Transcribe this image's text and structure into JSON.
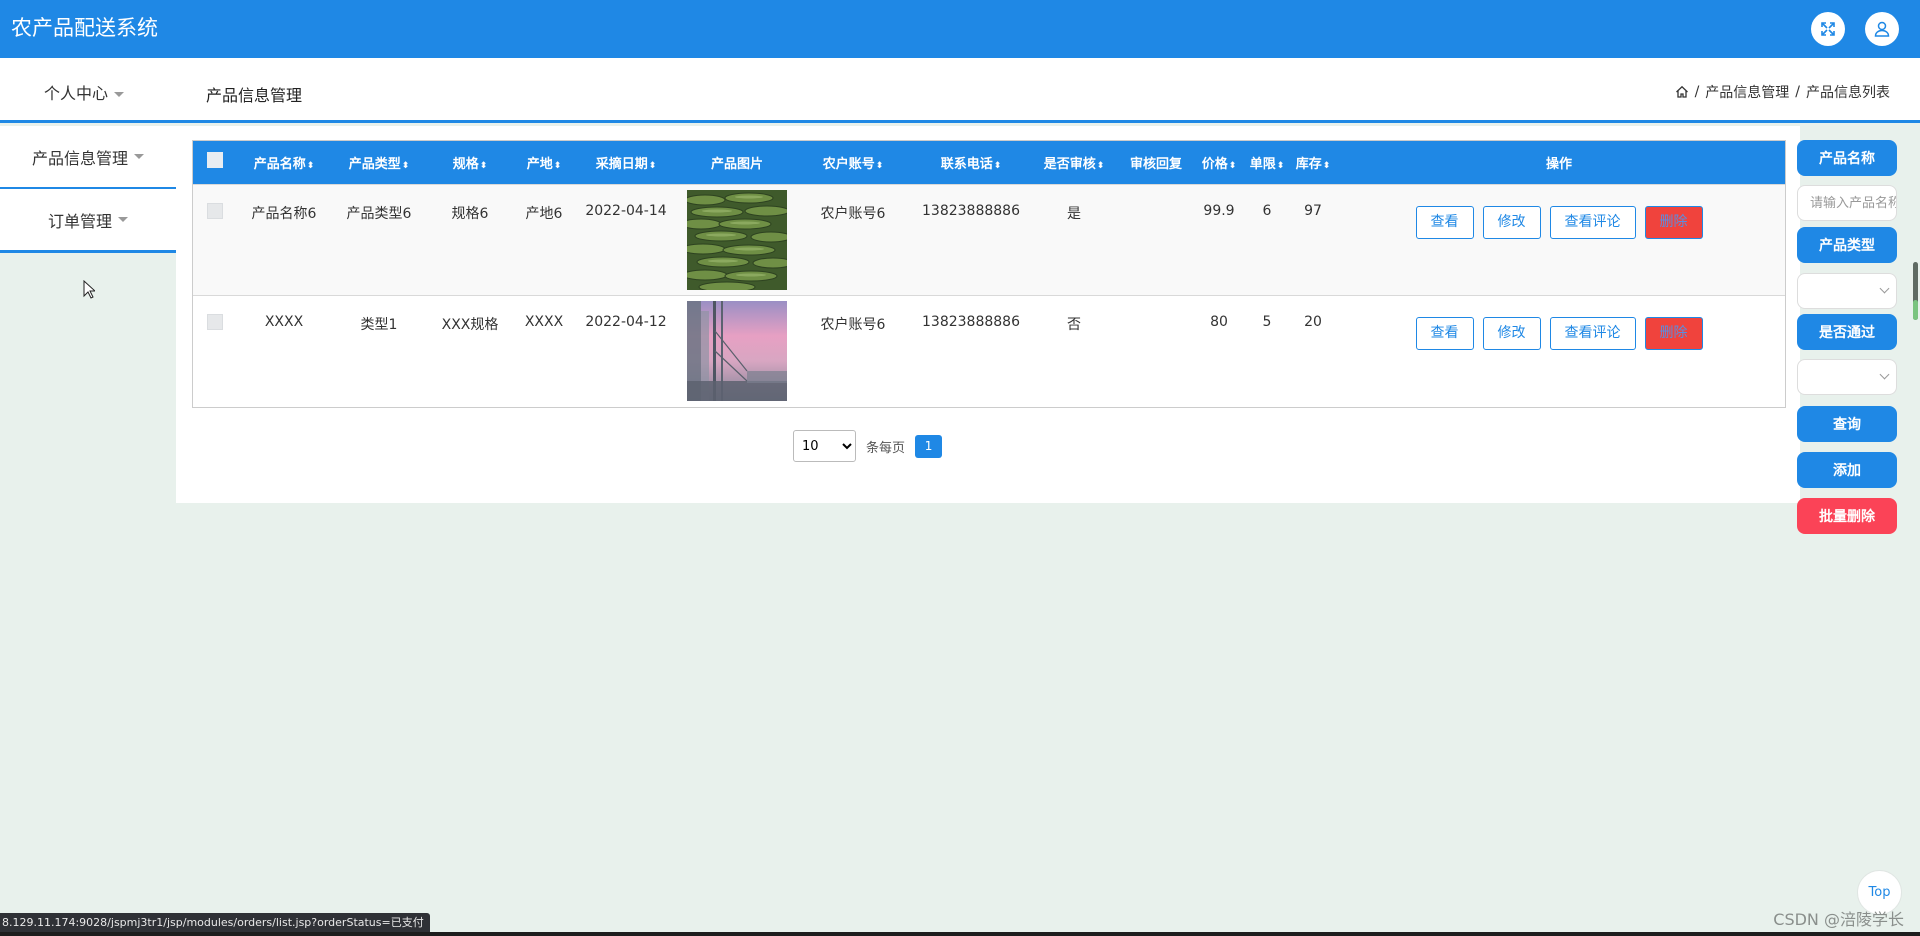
{
  "app": {
    "title": "农产品配送系统"
  },
  "header": {
    "personal_menu": "个人中心",
    "page_title": "产品信息管理",
    "breadcrumb": {
      "sep1": "/",
      "item1": "产品信息管理",
      "sep2": "/",
      "item2": "产品信息列表"
    }
  },
  "sidebar": {
    "items": [
      {
        "label": "产品信息管理"
      },
      {
        "label": "订单管理"
      }
    ]
  },
  "table": {
    "columns": [
      "产品名称",
      "产品类型",
      "规格",
      "产地",
      "采摘日期",
      "产品图片",
      "农户账号",
      "联系电话",
      "是否审核",
      "审核回复",
      "价格",
      "单限",
      "库存",
      "操作"
    ],
    "sortable_marker": "⬍",
    "rows": [
      {
        "name": "产品名称6",
        "type": "产品类型6",
        "spec": "规格6",
        "origin": "产地6",
        "date": "2022-04-14",
        "image": "cucumber",
        "farmer": "农户账号6",
        "phone": "13823888886",
        "audited": "是",
        "reply": "",
        "price": "99.9",
        "limit": "6",
        "stock": "97"
      },
      {
        "name": "XXXX",
        "type": "类型1",
        "spec": "XXX规格",
        "origin": "XXXX",
        "date": "2022-04-12",
        "image": "city-dusk",
        "farmer": "农户账号6",
        "phone": "13823888886",
        "audited": "否",
        "reply": "",
        "price": "80",
        "limit": "5",
        "stock": "20"
      }
    ],
    "actions": {
      "view": "查看",
      "edit": "修改",
      "view_comments": "查看评论",
      "delete": "删除"
    }
  },
  "pagination": {
    "page_size": "10",
    "per_page_label": "条每页",
    "current_page": "1"
  },
  "filters": {
    "name_label": "产品名称",
    "name_placeholder": "请输入产品名称",
    "type_label": "产品类型",
    "approved_label": "是否通过",
    "query": "查询",
    "add": "添加",
    "batch_delete": "批量删除"
  },
  "misc": {
    "top_button": "Top",
    "status_url": "8.129.11.174:9028/jspmj3tr1/jsp/modules/orders/list.jsp?orderStatus=已支付",
    "watermark": "CSDN @涪陵学长"
  },
  "colors": {
    "primary": "#1f88e5",
    "danger": "#f0433d",
    "batch_delete": "#fb4357",
    "background": "#e8f1ec"
  },
  "icons": {
    "fullscreen": "expand-icon",
    "user": "user-icon",
    "home": "home-icon"
  }
}
